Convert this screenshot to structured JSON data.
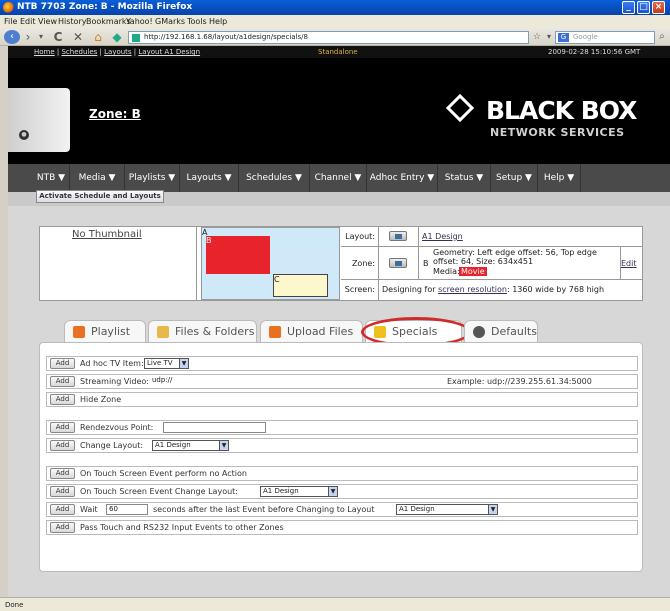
{
  "window": {
    "title": "NTB 7703 Zone: B - Mozilla Firefox"
  },
  "menu": [
    "File",
    "Edit",
    "View",
    "History",
    "Bookmarks",
    "Yahoo!",
    "GMarks",
    "Tools",
    "Help"
  ],
  "browser": {
    "url": "http://192.168.1.68/layout/a1design/specials/8",
    "search_placeholder": "Google"
  },
  "top_links": {
    "home": "Home",
    "schedules": "Schedules",
    "layouts": "Layouts",
    "layout": "Layout A1 Design",
    "mode": "Standalone",
    "clock": "2009-02-28 15:10:56 GMT"
  },
  "header": {
    "zone_title": "Zone: B",
    "logo_big": "BLACK BOX",
    "logo_small": "NETWORK SERVICES"
  },
  "nav": [
    "NTB ▼",
    "Media ▼",
    "Playlists ▼",
    "Layouts ▼",
    "Schedules ▼",
    "Channel ▼",
    "Adhoc Entry ▼",
    "Status ▼",
    "Setup ▼",
    "Help ▼"
  ],
  "activate_label": "Activate Schedule and Layouts",
  "info": {
    "no_thumbnail": "No Thumbnail",
    "zone_a": "A",
    "zone_b": "B",
    "zone_c": "C",
    "layout_label": "Layout:",
    "layout_value": "A1 Design",
    "zone_label": "Zone:",
    "zone_letter": "B",
    "zone_geometry": "Geometry: Left edge offset: 56, Top edge offset: 64, Size: 634x451",
    "media_label": "Media:",
    "media_value": "Movie",
    "edit_label": "Edit",
    "screen_label": "Screen:",
    "screen_prefix": "Designing for",
    "screen_link": "screen resolution",
    "screen_suffix": ": 1360 wide by 768 high"
  },
  "tabs": [
    "Playlist",
    "Files & Folders",
    "Upload Files",
    "Specials",
    "Defaults"
  ],
  "specials": {
    "add": "Add",
    "adhoc_label": "Ad hoc TV Item:",
    "adhoc_value": "Live TV",
    "streaming_label": "Streaming Video:",
    "streaming_value": "udp://",
    "streaming_example": "Example: udp://239.255.61.34:5000",
    "hide_zone": "Hide Zone",
    "rendezvous_label": "Rendezvous Point:",
    "change_layout_label": "Change Layout:",
    "change_layout_value": "A1 Design",
    "touch_no_action": "On Touch Screen Event perform no Action",
    "touch_change_label": "On Touch Screen Event Change Layout:",
    "touch_change_value": "A1 Design",
    "wait_label": "Wait",
    "wait_value": "60",
    "wait_suffix": "seconds after the last Event before Changing to Layout",
    "wait_layout_value": "A1 Design",
    "pass_touch": "Pass Touch and RS232 Input Events to other Zones"
  },
  "status": "Done"
}
